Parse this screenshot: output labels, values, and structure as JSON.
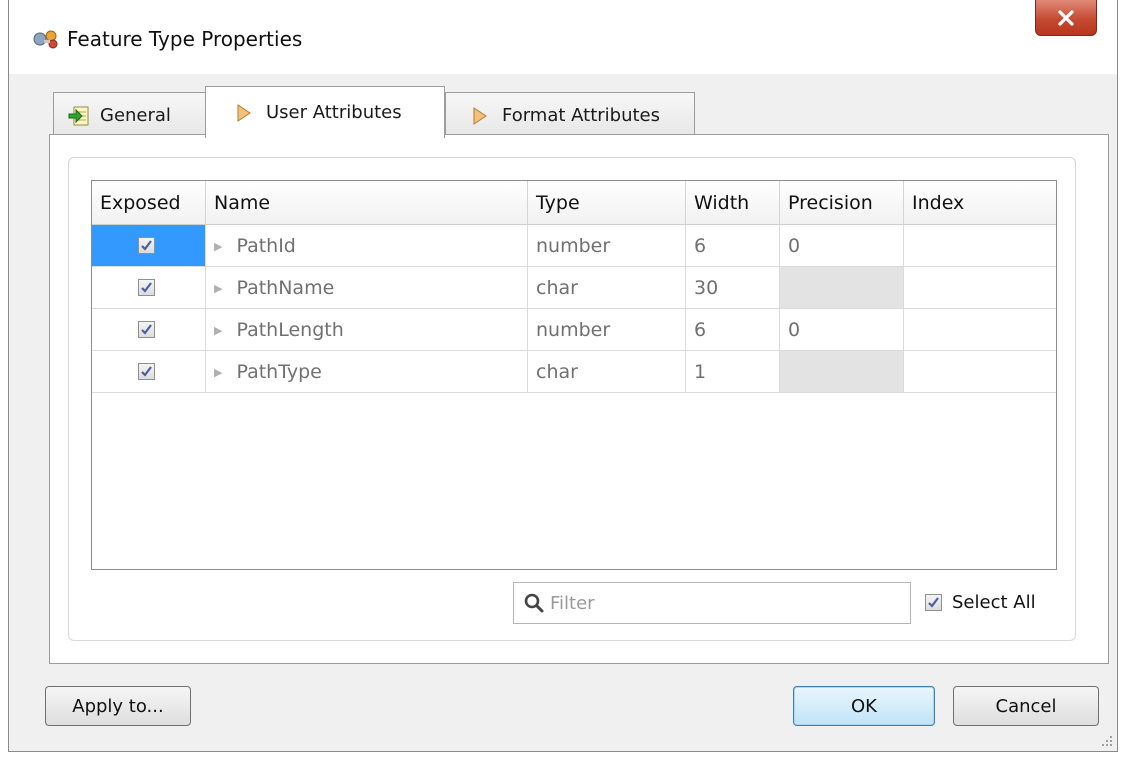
{
  "window": {
    "title": "Feature Type Properties",
    "close_label": "X"
  },
  "tabs": [
    {
      "label": "General",
      "icon": "green-arrow-icon"
    },
    {
      "label": "User Attributes",
      "icon": "attribute-diamond-icon"
    },
    {
      "label": "Format Attributes",
      "icon": "attribute-diamond-icon"
    }
  ],
  "active_tab": "User Attributes",
  "table": {
    "columns": [
      "Exposed",
      "Name",
      "Type",
      "Width",
      "Precision",
      "Index"
    ],
    "rows": [
      {
        "exposed": true,
        "name": "PathId",
        "type": "number",
        "width": "6",
        "precision": "0",
        "index": ""
      },
      {
        "exposed": true,
        "name": "PathName",
        "type": "char",
        "width": "30",
        "precision": "",
        "index": ""
      },
      {
        "exposed": true,
        "name": "PathLength",
        "type": "number",
        "width": "6",
        "precision": "0",
        "index": ""
      },
      {
        "exposed": true,
        "name": "PathType",
        "type": "char",
        "width": "1",
        "precision": "",
        "index": ""
      }
    ]
  },
  "filter": {
    "placeholder": "Filter",
    "value": ""
  },
  "select_all": {
    "label": "Select All",
    "checked": true
  },
  "buttons": {
    "apply": "Apply to...",
    "ok": "OK",
    "cancel": "Cancel"
  },
  "colors": {
    "selection": "#3399ff",
    "close_button": "#c44b32",
    "ok_border": "#3c7fb1"
  }
}
